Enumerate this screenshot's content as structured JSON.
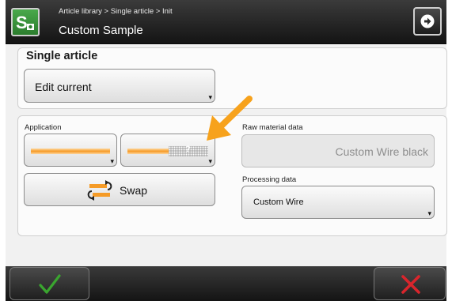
{
  "header": {
    "breadcrumb": "Article library > Single article > Init",
    "title": "Custom Sample",
    "logo_icon": "app-logo-icon",
    "next_icon": "arrow-right-icon"
  },
  "single_article": {
    "title": "Single article",
    "edit_button": "Edit current"
  },
  "application": {
    "label": "Application",
    "right_wire_marker": "?",
    "swap_button": "Swap"
  },
  "raw_material": {
    "label": "Raw material data",
    "value": "Custom Wire black"
  },
  "processing": {
    "label": "Processing data",
    "value": "Custom Wire"
  },
  "footer": {
    "ok_icon": "checkmark-icon",
    "cancel_icon": "close-x-icon"
  },
  "colors": {
    "wire": "#f59b27",
    "ok": "#3aa52f",
    "cancel": "#d9252c",
    "annotation_arrow": "#f7a21c"
  }
}
